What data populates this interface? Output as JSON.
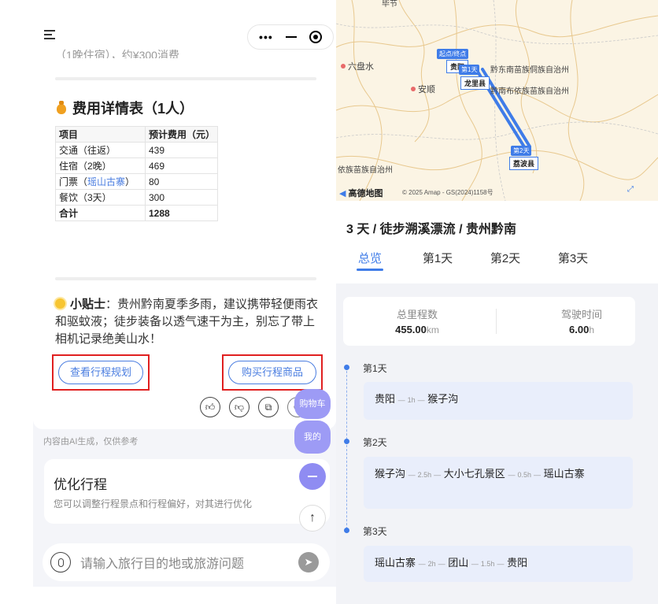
{
  "left": {
    "cut_text": "（1晚住宿），约¥300消费",
    "cost": {
      "title": "费用详情表（1人）",
      "header": [
        "项目",
        "预计费用（元）"
      ],
      "rows": [
        {
          "item": "交通（往返）",
          "cost": "439"
        },
        {
          "item": "住宿（2晚）",
          "cost": "469"
        },
        {
          "item_prefix": "门票（",
          "item_link": "瑶山古寨",
          "item_suffix": "）",
          "cost": "80"
        },
        {
          "item": "餐饮（3天）",
          "cost": "300"
        }
      ],
      "total": {
        "item": "合计",
        "cost": "1288"
      }
    },
    "tips": {
      "label": "小贴士",
      "text": "：贵州黔南夏季多雨，建议携带轻便雨衣和驱蚊液；徒步装备以透气速干为主，别忘了带上相机记录绝美山水！"
    },
    "buttons": {
      "view_plan": "查看行程规划",
      "buy_goods": "购买行程商品"
    },
    "floating": {
      "cart": "购物车",
      "mine": "我的"
    },
    "disclaimer": "内容由AI生成，仅供参考",
    "optimize": {
      "title": "优化行程",
      "subtitle": "您可以调整行程景点和行程偏好，对其进行优化"
    },
    "input": {
      "placeholder": "请输入旅行目的地或旅游问题"
    }
  },
  "right": {
    "map": {
      "labels": {
        "liupanshui": "六盘水",
        "anshun": "安顺",
        "qdn": "黔东南苗族侗族自治州",
        "qn": "黔南布依族苗族自治州",
        "qxn": "依族苗族自治州",
        "top_cut": "毕节"
      },
      "markers": {
        "start_end": "起点/终点",
        "guiyang": "贵阳",
        "day1": "第1天",
        "longli": "龙里县",
        "day2": "第2天",
        "libo": "荔波县"
      },
      "brand": "高德地图",
      "copyright": "© 2025 Amap - GS(2024)1158号"
    },
    "trip_title": "3 天 / 徒步溯溪漂流 / 贵州黔南",
    "tabs": [
      "总览",
      "第1天",
      "第2天",
      "第3天"
    ],
    "active_tab": 0,
    "stats": {
      "distance_label": "总里程数",
      "distance_value": "455.00",
      "distance_unit": "km",
      "drive_label": "驾驶时间",
      "drive_value": "6.00",
      "drive_unit": "h"
    },
    "days": [
      {
        "label": "第1天",
        "route": [
          {
            "place": "贵阳"
          },
          {
            "dur": "1h"
          },
          {
            "place": "猴子沟"
          }
        ]
      },
      {
        "label": "第2天",
        "route": [
          {
            "place": "猴子沟"
          },
          {
            "dur": "2.5h"
          },
          {
            "place": "大小七孔景区"
          },
          {
            "dur": "0.5h"
          },
          {
            "place": "瑶山古寨"
          }
        ]
      },
      {
        "label": "第3天",
        "route": [
          {
            "place": "瑶山古寨"
          },
          {
            "dur": "2h"
          },
          {
            "place": "团山"
          },
          {
            "dur": "1.5h"
          },
          {
            "place": "贵阳"
          }
        ]
      }
    ]
  }
}
